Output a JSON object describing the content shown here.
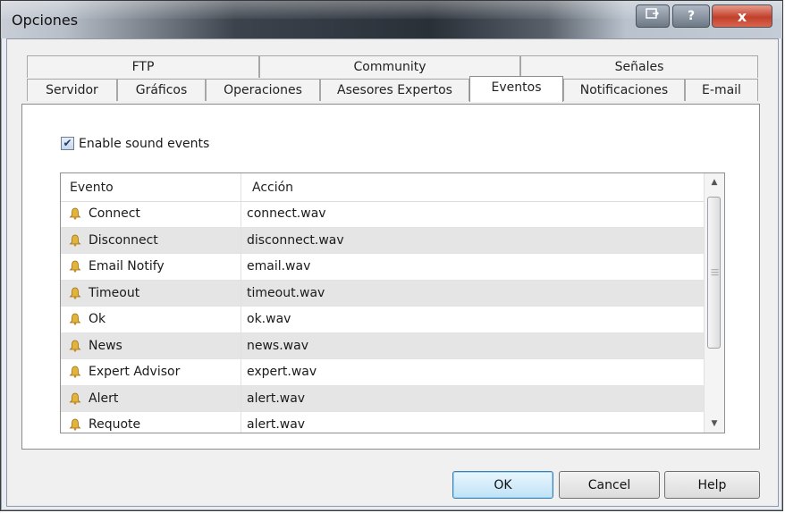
{
  "window": {
    "title": "Opciones",
    "controls": {
      "restore": "restore-icon",
      "help": "?",
      "close": "x"
    }
  },
  "tabs": {
    "row_top": [
      "FTP",
      "Community",
      "Señales"
    ],
    "row_bottom": [
      "Servidor",
      "Gráficos",
      "Operaciones",
      "Asesores Expertos",
      "Eventos",
      "Notificaciones",
      "E-mail"
    ],
    "active": "Eventos"
  },
  "sound": {
    "enable_label": "Enable sound events",
    "enabled": true
  },
  "events_table": {
    "columns": [
      "Evento",
      "Acción"
    ],
    "rows": [
      {
        "event": "Connect",
        "action": "connect.wav"
      },
      {
        "event": "Disconnect",
        "action": "disconnect.wav"
      },
      {
        "event": "Email Notify",
        "action": "email.wav"
      },
      {
        "event": "Timeout",
        "action": "timeout.wav"
      },
      {
        "event": "Ok",
        "action": "ok.wav"
      },
      {
        "event": "News",
        "action": "news.wav"
      },
      {
        "event": "Expert Advisor",
        "action": "expert.wav"
      },
      {
        "event": "Alert",
        "action": "alert.wav"
      },
      {
        "event": "Requote",
        "action": "alert.wav"
      }
    ]
  },
  "buttons": {
    "ok": "OK",
    "cancel": "Cancel",
    "help": "Help"
  }
}
